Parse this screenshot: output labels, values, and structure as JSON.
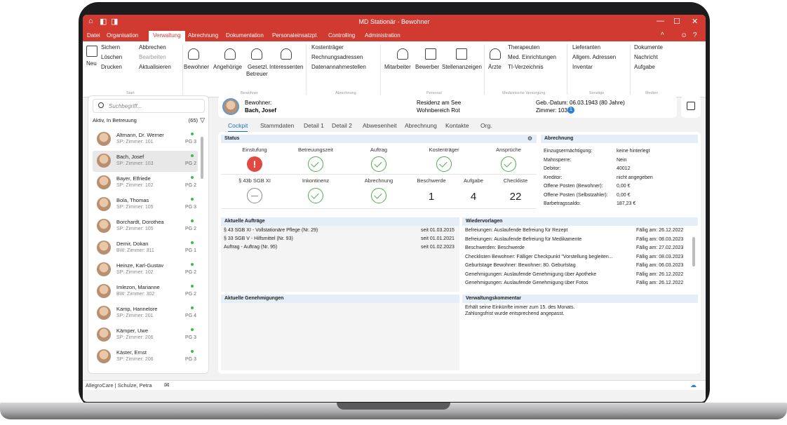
{
  "window": {
    "title": "MD Stationär - Bewohner"
  },
  "menu": [
    "Datei",
    "Organisation",
    "Verwaltung",
    "Abrechnung",
    "Dokumentation",
    "Personaleinsatzpl.",
    "Controlling",
    "Administration"
  ],
  "ribbon": {
    "start": {
      "neu": "Neu",
      "sichern": "Sichern",
      "abbrechen": "Abbrechen",
      "loeschen": "Löschen",
      "bearbeiten": "Bearbeiten",
      "drucken": "Drucken",
      "aktualisieren": "Aktualisieren",
      "group": "Start"
    },
    "bewohner": {
      "bewohner": "Bewohner",
      "angehoerige": "Angehörige",
      "gesetzl": "Gesetzl.",
      "betreuer": "Betreuer",
      "interessenten": "Interessenten",
      "group": "Bewohner"
    },
    "abrechnung": {
      "kostentraeger": "Kostenträger",
      "rechnungsadressen": "Rechnungsadressen",
      "datenannahme": "Datenannahmestellen",
      "group": "Abrechnung"
    },
    "personal": {
      "mitarbeiter": "Mitarbeiter",
      "bewerber": "Bewerber",
      "stellenanzeigen": "Stellenanzeigen",
      "group": "Personal"
    },
    "medizin": {
      "aerzte": "Ärzte",
      "therapeuten": "Therapeuten",
      "med": "Med. Einrichtungen",
      "ti": "TI-Verzeichnis",
      "group": "Medizinische Versorgung"
    },
    "sonstige": {
      "lieferanten": "Lieferanten",
      "adressen": "Allgem. Adressen",
      "inventar": "Inventar",
      "group": "Sonstige"
    },
    "medien": {
      "dokumente": "Dokumente",
      "nachricht": "Nachricht",
      "aufgabe": "Aufgabe",
      "group": "Medien"
    }
  },
  "left": {
    "search_placeholder": "Suchbegriff...",
    "filter": "Aktiv, In Betreuung",
    "count": "(65)",
    "residents": [
      {
        "name": "Altmann, Dr. Werner",
        "room": "SP: Zimmer: 101",
        "pg": "PG 3"
      },
      {
        "name": "Bach, Josef",
        "room": "SP: Zimmer: 103",
        "pg": "PG 2"
      },
      {
        "name": "Bayer, Elfriede",
        "room": "SP: Zimmer: 102",
        "pg": "PG 2"
      },
      {
        "name": "Bola, Thomas",
        "room": "SP: Zimmer: 105",
        "pg": "PG 3"
      },
      {
        "name": "Borchardt, Dorothea",
        "room": "SP: Zimmer: 105",
        "pg": "PG 2"
      },
      {
        "name": "Demir, Dokan",
        "room": "BW: Zimmer: 311",
        "pg": "PG 1"
      },
      {
        "name": "Heinze, Karl-Gustav",
        "room": "SP: Zimmer: 102",
        "pg": "PG 2"
      },
      {
        "name": "Imlezon, Marianne",
        "room": "BW: Zimmer: 302",
        "pg": "PG 2"
      },
      {
        "name": "Kamp, Hannelore",
        "room": "SP: Zimmer: 201",
        "pg": "PG 4"
      },
      {
        "name": "Kämper, Uwe",
        "room": "SP: Zimmer: 206",
        "pg": "PG 3"
      },
      {
        "name": "Käster, Ernst",
        "room": "SP: Zimmer: 206",
        "pg": "PG 3"
      }
    ]
  },
  "header": {
    "label": "Bewohner:",
    "name": "Bach, Josef",
    "facility": "Residenz am See",
    "ward": "Wohnbereich Rot",
    "birth": "Geb.-Datum: 06.03.1943 (80 Jahre)",
    "room": "Zimmer: 103",
    "room_badge": "1"
  },
  "tabs": [
    "Cockpit",
    "Stammdaten",
    "Detail 1",
    "Detail 2",
    "Abwesenheit",
    "Abrechnung",
    "Kontakte",
    "Org."
  ],
  "status": {
    "title": "Status",
    "row1": [
      "Einstufung",
      "Betreuungszeit",
      "Auftrag",
      "Kostenträger",
      "Ansprüche"
    ],
    "row2": [
      "§ 43b SGB XI",
      "Inkontinenz",
      "Abrechnung",
      "Beschwerde",
      "Aufgabe",
      "Checkliste"
    ],
    "numbers": [
      "1",
      "4",
      "22"
    ]
  },
  "billing": {
    "title": "Abrechnung",
    "rows": [
      [
        "Einzugsermächtigung:",
        "keine hinterlegt"
      ],
      [
        "Mahnsperre:",
        "Nein"
      ],
      [
        "Debitor:",
        "40012"
      ],
      [
        "Kreditor:",
        "nicht angegeben"
      ],
      [
        "Offene Posten (Bewohner):",
        "0,00 €"
      ],
      [
        "Offene Posten (Selbstzahler):",
        "0,00 €"
      ],
      [
        "Barbetragssaldo:",
        "187,23 €"
      ]
    ]
  },
  "orders": {
    "title": "Aktuelle Aufträge",
    "rows": [
      [
        "§ 43 SGB XI - Vollstationäre Pflege (Nr. 29)",
        "seit 01.03.2015"
      ],
      [
        "§ 33 SGB V - Hilfsmittel (Nr. 93)",
        "seit 01.01.2021"
      ],
      [
        "Auftrag - Auftrag (Nr. 95)",
        "seit 01.02.2023"
      ]
    ]
  },
  "approvals": {
    "title": "Aktuelle Genehmigungen"
  },
  "followups": {
    "title": "Wiedervorlagen",
    "rows": [
      [
        "Befreiungen: Auslaufende Befreiung für Rezept",
        "Fällig am: 26.12.2022"
      ],
      [
        "Befreiungen: Auslaufende Befreiung für Medikamente",
        "Fällig am: 08.03.2023"
      ],
      [
        "Beschwerden: Beschwerde",
        "Fällig am: 27.02.2023"
      ],
      [
        "Checklisten Bewohner: Fälliger Checkpunkt \"Vorstellung begleiten...",
        "Fällig am: 08.03.2023"
      ],
      [
        "Geburtstage Bewohner: Bewohner: 80. Geburtstag",
        "Fällig am: 06.03.2023"
      ],
      [
        "Genehmigungen: Auslaufende Genehmigung über Apotheke",
        "Fällig am: 26.12.2022"
      ],
      [
        "Genehmigungen: Auslaufende Genehmigung über Fotos",
        "Fällig am: 26.12.2022"
      ]
    ]
  },
  "comment": {
    "title": "Verwaltungskommentar",
    "text1": "Erhält seine Einkünfte immer zum 15. des Monats.",
    "text2": "Zahlungsfrist wurde entsprechend angepasst."
  },
  "statusbar": {
    "text": "AllegroCare | Schulze, Petra"
  }
}
